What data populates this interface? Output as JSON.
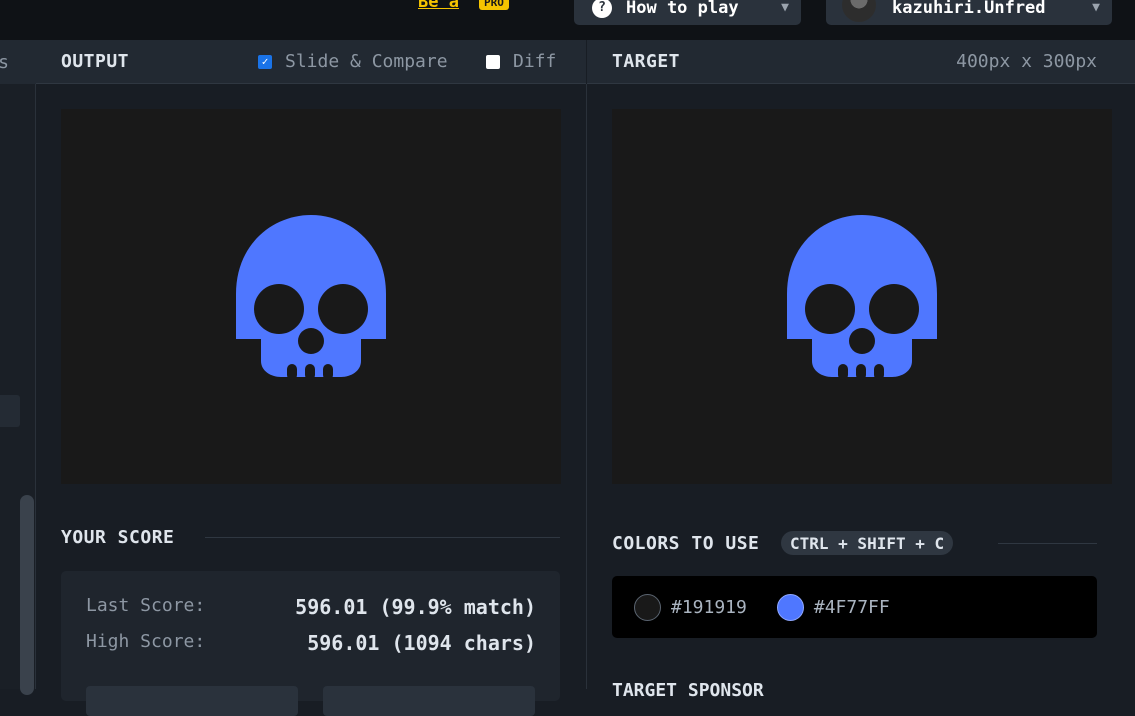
{
  "topbar": {
    "pro_link": "Be a",
    "pro_badge": "PRO",
    "how_to_play": "How to play",
    "username": "kazuhiri.Unfred"
  },
  "left_strip": {
    "tab_label": "s"
  },
  "output_panel": {
    "title": "OUTPUT",
    "slide_compare_label": "Slide & Compare",
    "slide_compare_checked": true,
    "diff_label": "Diff",
    "diff_checked": false
  },
  "target_panel": {
    "title": "TARGET",
    "dimensions": "400px x 300px"
  },
  "score": {
    "title": "YOUR SCORE",
    "last_label": "Last Score:",
    "last_value": "596.01 (99.9% match)",
    "high_label": "High Score:",
    "high_value": "596.01 (1094 chars)"
  },
  "colors": {
    "title": "COLORS TO USE",
    "shortcut": "CTRL + SHIFT + C",
    "items": [
      {
        "hex": "#191919"
      },
      {
        "hex": "#4F77FF"
      }
    ]
  },
  "sponsor": {
    "title": "TARGET SPONSOR"
  },
  "palette": {
    "background": "#191919",
    "skull": "#4F77FF",
    "pro_yellow": "#f5c400"
  }
}
